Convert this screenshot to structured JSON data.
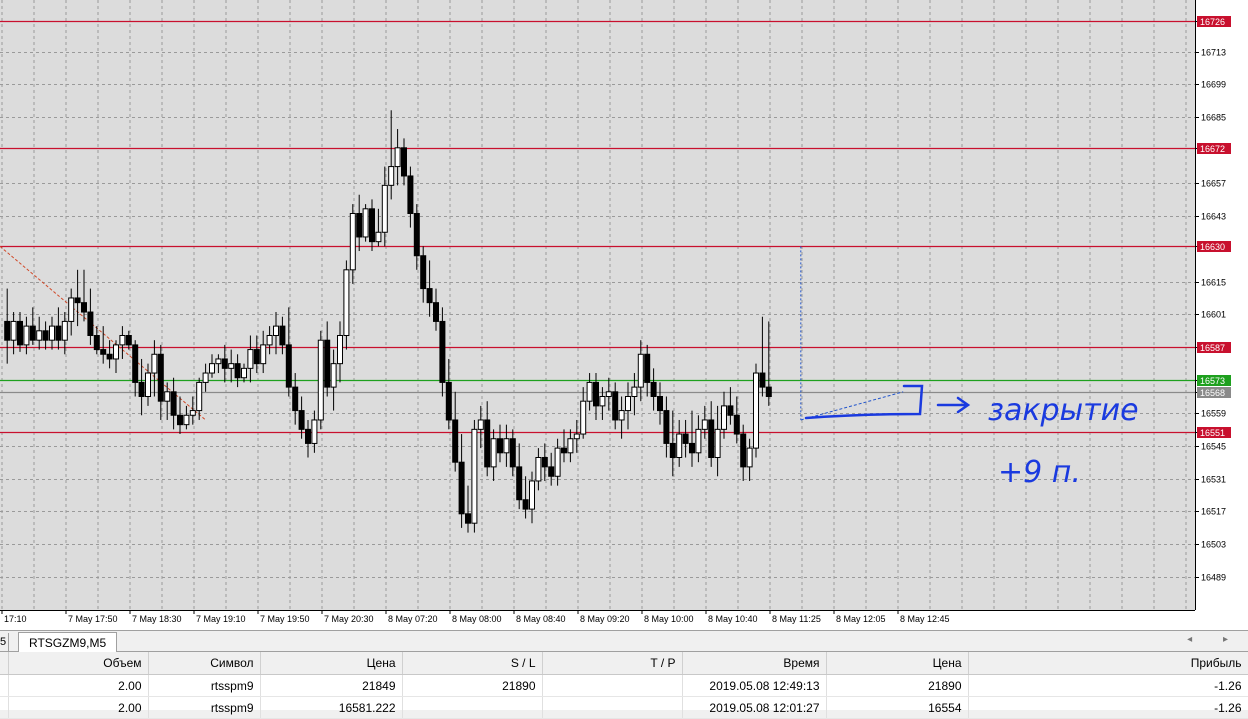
{
  "chart_data": {
    "type": "candlestick",
    "symbol": "RTSGZM9,M5",
    "ylim": [
      16475,
      16735
    ],
    "price_ticks": [
      "16726",
      "16713",
      "16699",
      "16685",
      "16672",
      "16657",
      "16643",
      "16630",
      "16615",
      "16601",
      "16587",
      "16573",
      "16568",
      "16559",
      "16551",
      "16545",
      "16531",
      "16517",
      "16503",
      "16489"
    ],
    "time_labels": [
      "17:10",
      "7 May 17:50",
      "7 May 18:30",
      "7 May 19:10",
      "7 May 19:50",
      "7 May 20:30",
      "8 May 07:20",
      "8 May 08:00",
      "8 May 08:40",
      "8 May 09:20",
      "8 May 10:00",
      "8 May 10:40",
      "8 May 11:25",
      "8 May 12:05",
      "8 May 12:45"
    ],
    "levels": [
      {
        "price": 16726,
        "label": "16726",
        "color": "#c8102e"
      },
      {
        "price": 16672,
        "label": "16672",
        "color": "#c8102e"
      },
      {
        "price": 16630,
        "label": "16630",
        "color": "#c8102e"
      },
      {
        "price": 16587,
        "label": "16587",
        "color": "#c8102e"
      },
      {
        "price": 16573,
        "label": "16573",
        "color": "#1ea01e"
      },
      {
        "price": 16568,
        "label": "16568",
        "color": "#8a8a8a"
      },
      {
        "price": 16551,
        "label": "16551",
        "color": "#c8102e"
      }
    ],
    "candles": [
      [
        16598,
        16612,
        16580,
        16590
      ],
      [
        16590,
        16602,
        16584,
        16598
      ],
      [
        16598,
        16602,
        16585,
        16588
      ],
      [
        16588,
        16600,
        16584,
        16596
      ],
      [
        16596,
        16604,
        16588,
        16590
      ],
      [
        16590,
        16600,
        16586,
        16594
      ],
      [
        16594,
        16598,
        16586,
        16590
      ],
      [
        16590,
        16600,
        16586,
        16596
      ],
      [
        16596,
        16604,
        16586,
        16590
      ],
      [
        16590,
        16602,
        16584,
        16598
      ],
      [
        16598,
        16612,
        16592,
        16608
      ],
      [
        16608,
        16620,
        16596,
        16606
      ],
      [
        16606,
        16620,
        16598,
        16602
      ],
      [
        16602,
        16612,
        16588,
        16592
      ],
      [
        16592,
        16596,
        16584,
        16586
      ],
      [
        16586,
        16596,
        16580,
        16584
      ],
      [
        16584,
        16590,
        16578,
        16582
      ],
      [
        16582,
        16590,
        16576,
        16588
      ],
      [
        16588,
        16596,
        16582,
        16592
      ],
      [
        16592,
        16594,
        16586,
        16588
      ],
      [
        16588,
        16590,
        16566,
        16572
      ],
      [
        16572,
        16582,
        16558,
        16566
      ],
      [
        16566,
        16580,
        16562,
        16576
      ],
      [
        16576,
        16590,
        16566,
        16584
      ],
      [
        16584,
        16588,
        16556,
        16564
      ],
      [
        16564,
        16572,
        16556,
        16568
      ],
      [
        16568,
        16574,
        16552,
        16558
      ],
      [
        16558,
        16566,
        16550,
        16554
      ],
      [
        16554,
        16562,
        16552,
        16558
      ],
      [
        16558,
        16566,
        16554,
        16560
      ],
      [
        16560,
        16574,
        16556,
        16572
      ],
      [
        16572,
        16580,
        16568,
        16576
      ],
      [
        16576,
        16584,
        16574,
        16580
      ],
      [
        16580,
        16584,
        16576,
        16582
      ],
      [
        16582,
        16588,
        16572,
        16578
      ],
      [
        16578,
        16586,
        16572,
        16580
      ],
      [
        16580,
        16584,
        16570,
        16574
      ],
      [
        16574,
        16580,
        16572,
        16578
      ],
      [
        16578,
        16592,
        16572,
        16586
      ],
      [
        16586,
        16592,
        16576,
        16580
      ],
      [
        16580,
        16594,
        16576,
        16588
      ],
      [
        16588,
        16596,
        16584,
        16592
      ],
      [
        16592,
        16602,
        16584,
        16596
      ],
      [
        16596,
        16600,
        16584,
        16588
      ],
      [
        16588,
        16604,
        16566,
        16570
      ],
      [
        16570,
        16576,
        16554,
        16560
      ],
      [
        16560,
        16566,
        16548,
        16552
      ],
      [
        16552,
        16556,
        16540,
        16546
      ],
      [
        16546,
        16560,
        16542,
        16556
      ],
      [
        16556,
        16594,
        16552,
        16590
      ],
      [
        16590,
        16598,
        16566,
        16570
      ],
      [
        16570,
        16586,
        16560,
        16580
      ],
      [
        16580,
        16598,
        16572,
        16592
      ],
      [
        16592,
        16624,
        16586,
        16620
      ],
      [
        16620,
        16648,
        16614,
        16644
      ],
      [
        16644,
        16652,
        16628,
        16634
      ],
      [
        16634,
        16648,
        16632,
        16646
      ],
      [
        16646,
        16650,
        16628,
        16632
      ],
      [
        16632,
        16646,
        16630,
        16636
      ],
      [
        16636,
        16664,
        16630,
        16656
      ],
      [
        16656,
        16688,
        16650,
        16664
      ],
      [
        16664,
        16680,
        16656,
        16672
      ],
      [
        16672,
        16676,
        16656,
        16660
      ],
      [
        16660,
        16664,
        16638,
        16644
      ],
      [
        16644,
        16648,
        16620,
        16626
      ],
      [
        16626,
        16630,
        16606,
        16612
      ],
      [
        16612,
        16624,
        16600,
        16606
      ],
      [
        16606,
        16612,
        16594,
        16598
      ],
      [
        16598,
        16604,
        16566,
        16572
      ],
      [
        16572,
        16582,
        16552,
        16556
      ],
      [
        16556,
        16568,
        16534,
        16538
      ],
      [
        16538,
        16550,
        16510,
        16516
      ],
      [
        16516,
        16528,
        16508,
        16512
      ],
      [
        16512,
        16556,
        16508,
        16552
      ],
      [
        16552,
        16562,
        16544,
        16556
      ],
      [
        16556,
        16564,
        16532,
        16536
      ],
      [
        16536,
        16552,
        16530,
        16548
      ],
      [
        16548,
        16554,
        16538,
        16542
      ],
      [
        16542,
        16554,
        16536,
        16548
      ],
      [
        16548,
        16552,
        16532,
        16536
      ],
      [
        16536,
        16546,
        16518,
        16522
      ],
      [
        16522,
        16532,
        16514,
        16518
      ],
      [
        16518,
        16534,
        16512,
        16530
      ],
      [
        16530,
        16544,
        16526,
        16540
      ],
      [
        16540,
        16546,
        16530,
        16536
      ],
      [
        16536,
        16542,
        16528,
        16532
      ],
      [
        16532,
        16548,
        16528,
        16544
      ],
      [
        16544,
        16552,
        16538,
        16542
      ],
      [
        16542,
        16552,
        16538,
        16548
      ],
      [
        16548,
        16556,
        16542,
        16550
      ],
      [
        16550,
        16570,
        16548,
        16564
      ],
      [
        16564,
        16576,
        16560,
        16572
      ],
      [
        16572,
        16576,
        16556,
        16562
      ],
      [
        16562,
        16570,
        16556,
        16566
      ],
      [
        16566,
        16574,
        16560,
        16568
      ],
      [
        16568,
        16572,
        16552,
        16556
      ],
      [
        16556,
        16566,
        16548,
        16560
      ],
      [
        16560,
        16572,
        16552,
        16566
      ],
      [
        16566,
        16576,
        16558,
        16570
      ],
      [
        16570,
        16590,
        16564,
        16584
      ],
      [
        16584,
        16588,
        16566,
        16572
      ],
      [
        16572,
        16578,
        16560,
        16566
      ],
      [
        16566,
        16572,
        16554,
        16560
      ],
      [
        16560,
        16566,
        16540,
        16546
      ],
      [
        16546,
        16560,
        16532,
        16540
      ],
      [
        16540,
        16556,
        16536,
        16550
      ],
      [
        16550,
        16556,
        16540,
        16546
      ],
      [
        16546,
        16560,
        16536,
        16542
      ],
      [
        16542,
        16558,
        16538,
        16552
      ],
      [
        16552,
        16562,
        16548,
        16556
      ],
      [
        16556,
        16564,
        16536,
        16540
      ],
      [
        16540,
        16562,
        16532,
        16552
      ],
      [
        16552,
        16568,
        16548,
        16562
      ],
      [
        16562,
        16570,
        16554,
        16558
      ],
      [
        16558,
        16566,
        16546,
        16550
      ],
      [
        16550,
        16554,
        16530,
        16536
      ],
      [
        16536,
        16548,
        16530,
        16544
      ],
      [
        16544,
        16580,
        16540,
        16576
      ],
      [
        16576,
        16600,
        16566,
        16570
      ],
      [
        16570,
        16598,
        16562,
        16566
      ]
    ],
    "annotation_text": [
      "→ закрытие",
      "+9 п."
    ]
  },
  "tabs": {
    "stub": "5",
    "active": "RTSGZM9,M5",
    "arrows": "◂ ▸"
  },
  "orders_table": {
    "headers": [
      "",
      "Объем",
      "Символ",
      "Цена",
      "S / L",
      "T / P",
      "Время",
      "Цена",
      "Прибыль"
    ],
    "rows": [
      [
        "",
        "2.00",
        "rtsspm9",
        "21849",
        "21890",
        "",
        "2019.05.08 12:49:13",
        "21890",
        "-1.26"
      ],
      [
        "",
        "2.00",
        "rtsspm9",
        "16581.222",
        "",
        "",
        "2019.05.08 12:01:27",
        "16554",
        "-1.26"
      ]
    ]
  }
}
